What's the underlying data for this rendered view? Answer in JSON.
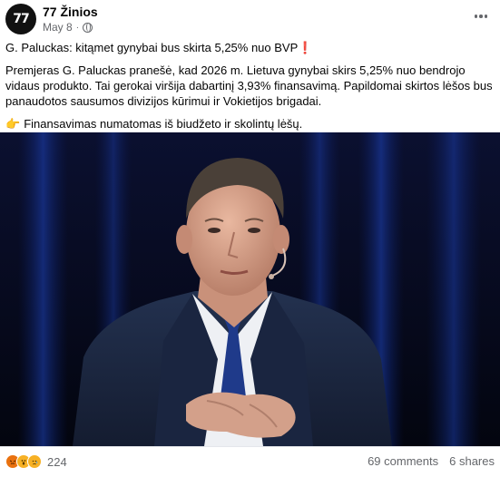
{
  "post": {
    "page_name": "77 Žinios",
    "avatar_mark": "77",
    "date": "May 8",
    "date_separator": "·",
    "headline": "G. Paluckas: kitąmet gynybai bus skirta 5,25% nuo BVP",
    "headline_mark": "❗",
    "body": "Premjeras G. Paluckas pranešė, kad 2026 m. Lietuva gynybai skirs 5,25% nuo bendrojo vidaus produkto. Tai gerokai viršija dabartinį 3,93% finansavimą. Papildomai skirtos lėšos bus panaudotos sausumos divizijos kūrimui ir Vokietijos brigadai.",
    "note_icon": "👉",
    "note": "Finansavimas numatomas iš biudžeto ir skolintų lėšų."
  },
  "footer": {
    "reaction_count": "224",
    "comments": "69 comments",
    "shares": "6 shares"
  },
  "colors": {
    "accent_text": "#050505",
    "secondary_text": "#65676b",
    "angry": "#e9710f",
    "wow": "#f7b125",
    "divider": "#e4e6eb"
  },
  "icons": [
    "page-avatar-icon",
    "globe-icon",
    "more-options-icon",
    "pointing-hand-icon",
    "angry-reaction-icon",
    "wow-reaction-icon",
    "sad-reaction-icon"
  ]
}
